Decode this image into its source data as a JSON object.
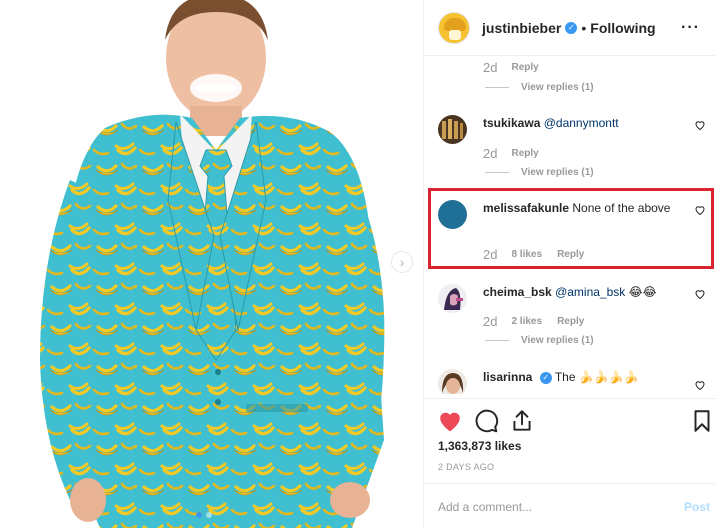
{
  "post": {
    "username": "justinbieber",
    "separator": "•",
    "follow_label": "Following",
    "more_icon": "more-horizontal-icon"
  },
  "comments": [
    {
      "id": "partial",
      "time": "2d",
      "likes": "",
      "reply_label": "Reply",
      "view_replies": "View replies (1)"
    },
    {
      "id": "tsukikawa",
      "username": "tsukikawa",
      "mention": "@dannymontt",
      "text": "",
      "time": "2d",
      "likes": "",
      "reply_label": "Reply",
      "view_replies": "View replies (1)"
    },
    {
      "id": "melissafakunle",
      "username": "melissafakunle",
      "text": "None of the above",
      "time": "2d",
      "likes": "8 likes",
      "reply_label": "Reply"
    },
    {
      "id": "cheima_bsk",
      "username": "cheima_bsk",
      "mention": "@amina_bsk",
      "emoji": "😂😂",
      "time": "2d",
      "likes": "2 likes",
      "reply_label": "Reply",
      "view_replies": "View replies (1)"
    },
    {
      "id": "lisarinna",
      "username": "lisarinna",
      "text": "The",
      "emoji": "🍌🍌🍌🍌"
    }
  ],
  "actions": {
    "like_icon": "heart-filled-icon",
    "comment_icon": "comment-icon",
    "share_icon": "share-icon",
    "save_icon": "bookmark-icon",
    "likes_count": "1,363,873 likes",
    "date": "2 DAYS AGO"
  },
  "add_comment": {
    "placeholder": "Add a comment...",
    "post_label": "Post"
  },
  "colors": {
    "suit": "#3fbfcf",
    "banana": "#f3c928",
    "like_red": "#ed4956",
    "link_blue": "#003569",
    "highlight": "#d9232e"
  }
}
